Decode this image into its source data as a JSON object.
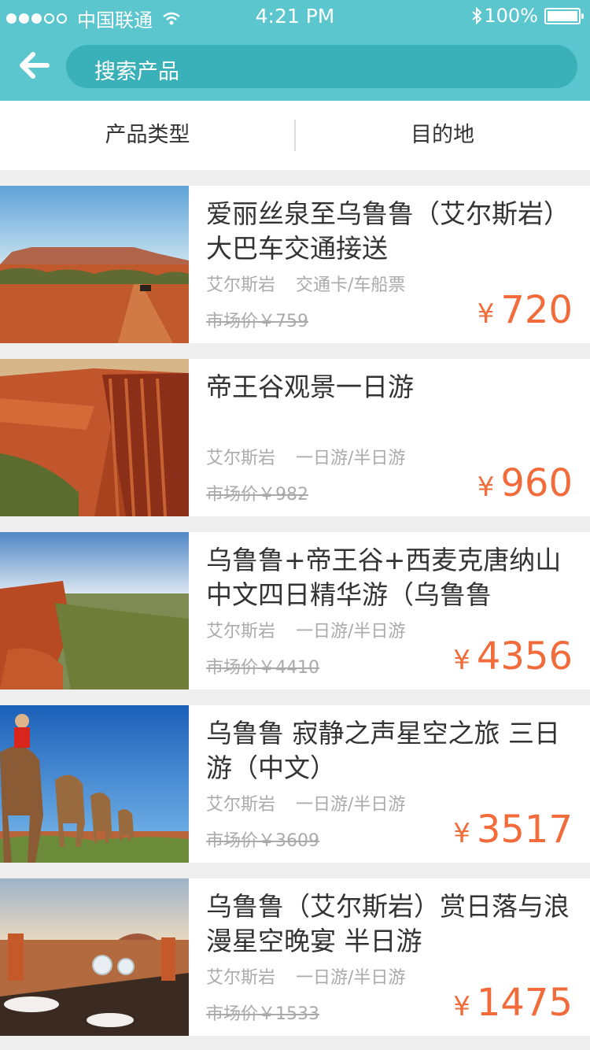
{
  "status_bar": {
    "carrier": "中国联通",
    "time": "4:21 PM",
    "battery": "100%"
  },
  "header": {
    "search_placeholder": "搜索产品"
  },
  "filters": {
    "product_type": "产品类型",
    "destination": "目的地"
  },
  "colors": {
    "header_bg": "#5bc6cd",
    "search_bg": "#3ab1b8",
    "price": "#f26b3a"
  },
  "currency_symbol": "¥",
  "products": [
    {
      "title": "爱丽丝泉至乌鲁鲁（艾尔斯岩）大巴车交通接送",
      "location": "艾尔斯岩",
      "category": "交通卡/车船票",
      "market_price": "市场价￥759",
      "price": "720"
    },
    {
      "title": "帝王谷观景一日游",
      "location": "艾尔斯岩",
      "category": "一日游/半日游",
      "market_price": "市场价￥982",
      "price": "960"
    },
    {
      "title": "乌鲁鲁+帝王谷+西麦克唐纳山 中文四日精华游（乌鲁鲁",
      "location": "艾尔斯岩",
      "category": "一日游/半日游",
      "market_price": "市场价￥4410",
      "price": "4356"
    },
    {
      "title": "乌鲁鲁 寂静之声星空之旅 三日游（中文）",
      "location": "艾尔斯岩",
      "category": "一日游/半日游",
      "market_price": "市场价￥3609",
      "price": "3517"
    },
    {
      "title": "乌鲁鲁（艾尔斯岩）赏日落与浪漫星空晚宴 半日游",
      "location": "艾尔斯岩",
      "category": "一日游/半日游",
      "market_price": "市场价￥1533",
      "price": "1475"
    }
  ]
}
